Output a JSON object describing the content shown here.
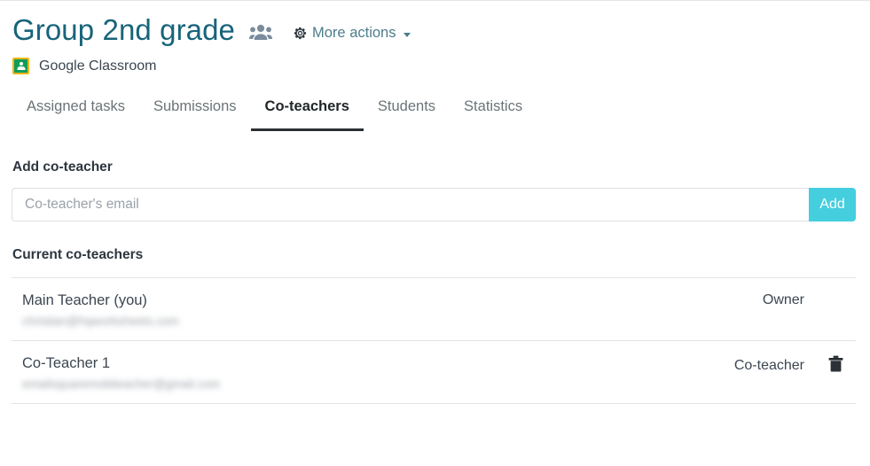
{
  "header": {
    "title": "Group 2nd grade",
    "group_icon": "people-group-icon",
    "more_actions_label": "More actions",
    "gear_icon": "gear-icon",
    "caret_icon": "chevron-down-icon"
  },
  "source": {
    "icon": "google-classroom-icon",
    "label": "Google Classroom"
  },
  "tabs": [
    {
      "label": "Assigned tasks",
      "active": false
    },
    {
      "label": "Submissions",
      "active": false
    },
    {
      "label": "Co-teachers",
      "active": true
    },
    {
      "label": "Students",
      "active": false
    },
    {
      "label": "Statistics",
      "active": false
    }
  ],
  "add_section": {
    "label": "Add co-teacher",
    "input_placeholder": "Co-teacher's email",
    "input_value": "",
    "add_button_label": "Add"
  },
  "current_section": {
    "label": "Current co-teachers",
    "rows": [
      {
        "name": "Main Teacher (you)",
        "email": "christian@hqworksheets.com",
        "role": "Owner",
        "deletable": false
      },
      {
        "name": "Co-Teacher 1",
        "email": "emailsquaremobiteacher@gmail.com",
        "role": "Co-teacher",
        "deletable": true
      }
    ]
  },
  "colors": {
    "title": "#17647a",
    "accent_add_button": "#44cede",
    "classroom_green": "#0f9d58",
    "classroom_yellow": "#f5b415",
    "active_tab_underline": "#2b2f33",
    "divider": "#e2e4e7"
  }
}
